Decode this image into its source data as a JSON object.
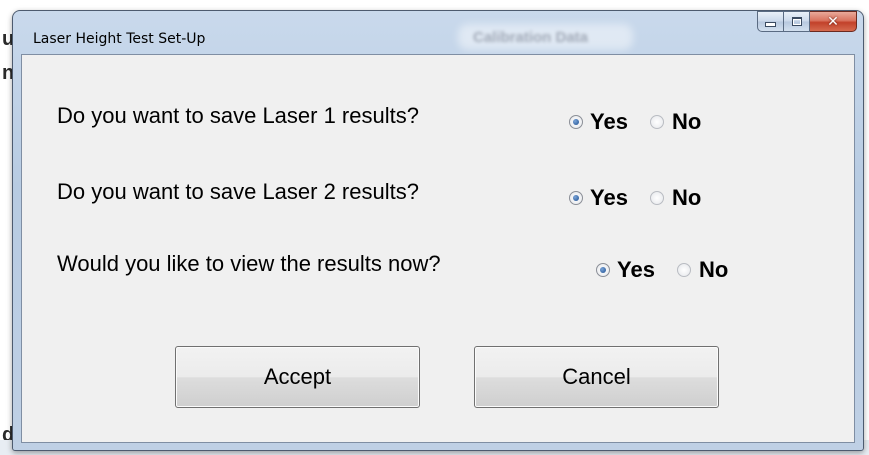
{
  "window": {
    "title": "Laser Height Test Set-Up",
    "background_title": "Calibration Data"
  },
  "background": {
    "chars": [
      "u",
      "n",
      "d"
    ]
  },
  "questions": [
    {
      "text": "Do you want to save Laser 1 results?",
      "yes_label": "Yes",
      "no_label": "No",
      "selected": "Yes"
    },
    {
      "text": "Do you want to save Laser 2 results?",
      "yes_label": "Yes",
      "no_label": "No",
      "selected": "Yes"
    },
    {
      "text": "Would you like to view the results now?",
      "yes_label": "Yes",
      "no_label": "No",
      "selected": "Yes"
    }
  ],
  "buttons": {
    "accept_label": "Accept",
    "cancel_label": "Cancel"
  },
  "colors": {
    "titlebar": "#bfd0e5",
    "client_background": "#f0f0f0",
    "close_button": "#c2412a",
    "radio_selected": "#1d4f91"
  },
  "icons": [
    "minimize-icon",
    "maximize-icon",
    "close-icon"
  ]
}
